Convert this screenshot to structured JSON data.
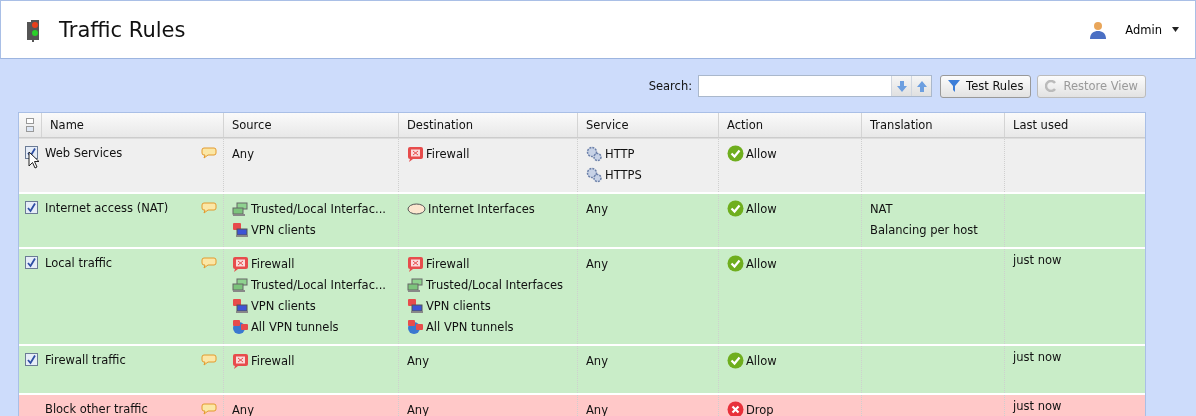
{
  "header": {
    "title": "Traffic Rules",
    "user": "Admin"
  },
  "toolbar": {
    "search_label": "Search:",
    "buttons": [
      {
        "kind": "test",
        "label": "Test Rules",
        "disabled": false
      },
      {
        "kind": "restore",
        "label": "Restore View",
        "disabled": true
      }
    ]
  },
  "table": {
    "columns": [
      "Name",
      "Source",
      "Destination",
      "Service",
      "Action",
      "Translation",
      "Last used"
    ],
    "rows": [
      {
        "kind": "rule",
        "selected": true,
        "checked": true,
        "name": "Web Services",
        "source": [
          {
            "kind": "any",
            "label": "Any"
          }
        ],
        "destination": [
          {
            "kind": "firewall",
            "label": "Firewall"
          }
        ],
        "service": [
          {
            "kind": "service",
            "label": "HTTP"
          },
          {
            "kind": "service",
            "label": "HTTPS"
          }
        ],
        "action": {
          "kind": "allow",
          "label": "Allow"
        },
        "translation": [],
        "last_used": ""
      },
      {
        "kind": "rule",
        "selected": false,
        "checked": true,
        "name": "Internet access (NAT)",
        "source": [
          {
            "kind": "interfaces",
            "label": "Trusted/Local Interfac..."
          },
          {
            "kind": "vpn-clients",
            "label": "VPN clients"
          }
        ],
        "destination": [
          {
            "kind": "internet",
            "label": "Internet Interfaces"
          }
        ],
        "service": [
          {
            "kind": "any",
            "label": "Any"
          }
        ],
        "action": {
          "kind": "allow",
          "label": "Allow"
        },
        "translation": [
          "NAT",
          "Balancing per host"
        ],
        "last_used": ""
      },
      {
        "kind": "rule",
        "selected": false,
        "checked": true,
        "name": "Local traffic",
        "source": [
          {
            "kind": "firewall",
            "label": "Firewall"
          },
          {
            "kind": "interfaces",
            "label": "Trusted/Local Interfac..."
          },
          {
            "kind": "vpn-clients",
            "label": "VPN clients"
          },
          {
            "kind": "vpn-tunnels",
            "label": "All VPN tunnels"
          }
        ],
        "destination": [
          {
            "kind": "firewall",
            "label": "Firewall"
          },
          {
            "kind": "interfaces",
            "label": "Trusted/Local Interfaces"
          },
          {
            "kind": "vpn-clients",
            "label": "VPN clients"
          },
          {
            "kind": "vpn-tunnels",
            "label": "All VPN tunnels"
          }
        ],
        "service": [
          {
            "kind": "any",
            "label": "Any"
          }
        ],
        "action": {
          "kind": "allow",
          "label": "Allow"
        },
        "translation": [],
        "last_used": "just now"
      },
      {
        "kind": "rule",
        "selected": false,
        "checked": true,
        "name": "Firewall traffic",
        "source": [
          {
            "kind": "firewall",
            "label": "Firewall"
          }
        ],
        "destination": [
          {
            "kind": "any",
            "label": "Any"
          }
        ],
        "service": [
          {
            "kind": "any",
            "label": "Any"
          }
        ],
        "action": {
          "kind": "allow",
          "label": "Allow"
        },
        "translation": [],
        "last_used": "just now"
      },
      {
        "kind": "default",
        "selected": false,
        "name": "Block other traffic",
        "source": [
          {
            "kind": "any",
            "label": "Any"
          }
        ],
        "destination": [
          {
            "kind": "any",
            "label": "Any"
          }
        ],
        "service": [
          {
            "kind": "any",
            "label": "Any"
          }
        ],
        "action": {
          "kind": "drop",
          "label": "Drop"
        },
        "translation": [],
        "last_used": "just now"
      }
    ]
  }
}
